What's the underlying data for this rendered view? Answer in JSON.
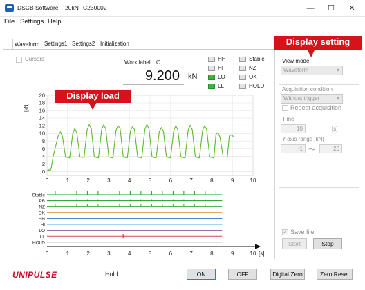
{
  "window": {
    "title_app": "DSCB Software",
    "title_capacity": "20kN",
    "title_serial": "C230002",
    "controls": [
      "—",
      "☐",
      "✕"
    ]
  },
  "menu": [
    "File",
    "Settings",
    "Help"
  ],
  "tabs": [
    "Waveform",
    "Settings1",
    "Settings2",
    "Initialization"
  ],
  "cursors_label": "Cursors",
  "work_label": {
    "label": "Work label:",
    "value": "O"
  },
  "load": {
    "value": "9.200",
    "unit": "kN"
  },
  "judgments": [
    {
      "label": "HH",
      "on": false
    },
    {
      "label": "HI",
      "on": false
    },
    {
      "label": "LO",
      "on": true
    },
    {
      "label": "LL",
      "on": true
    }
  ],
  "states": [
    {
      "label": "Stable",
      "on": false
    },
    {
      "label": "NZ",
      "on": false
    },
    {
      "label": "OK",
      "on": false
    },
    {
      "label": "HOLD",
      "on": false
    }
  ],
  "settings_panel": {
    "view_mode_label": "View mode",
    "view_mode_value": "Waveform",
    "acquisition_label": "Acquisition condition",
    "acquisition_value": "Without trigger",
    "repeat_label": "Repeat acquisition",
    "time_label": "Time",
    "time_value": "10",
    "time_unit": "[s]",
    "yrange_label": "Y-axis range [kN]",
    "yrange_min": "-1",
    "yrange_sep": "〜",
    "yrange_max": "20",
    "save_label": "Save file",
    "start_label": "Start",
    "stop_label": "Stop"
  },
  "callouts": {
    "display_load": "Display load",
    "display_setting": "Display setting"
  },
  "footer": {
    "brand": "UNIPULSE",
    "hold_label": "Hold :",
    "on_label": "ON",
    "off_label": "OFF",
    "digital_zero": "Digital Zero",
    "zero_reset": "Zero Reset"
  },
  "colors": {
    "trace": "#5cb82e",
    "callout": "#d7121a",
    "lamp_on": "#3db43d",
    "brand": "#c8102e"
  },
  "chart_data": {
    "type": "line",
    "ylabel": "[kN]",
    "xlabel": "[s]",
    "xlim": [
      0,
      10
    ],
    "ylim": [
      -1,
      20
    ],
    "x_ticks": [
      0,
      1,
      2,
      3,
      4,
      5,
      6,
      7,
      8,
      9,
      10
    ],
    "y_ticks": [
      0,
      2,
      4,
      6,
      8,
      10,
      12,
      14,
      16,
      18,
      20
    ],
    "grid": true,
    "series": [
      {
        "x": [
          0.0,
          0.05,
          0.1,
          0.15,
          0.2,
          0.3,
          0.55,
          0.65,
          0.75,
          0.9,
          1.1,
          1.25,
          1.35,
          1.45,
          1.6,
          1.8,
          1.95,
          2.05,
          2.15,
          2.3,
          2.5,
          2.65,
          2.75,
          2.85,
          3.0,
          3.2,
          3.35,
          3.45,
          3.55,
          3.7,
          3.9,
          4.05,
          4.15,
          4.25,
          4.4,
          4.6,
          4.75,
          4.85,
          4.95,
          5.1,
          5.3,
          5.45,
          5.55,
          5.65,
          5.8,
          6.0,
          6.15,
          6.25,
          6.35,
          6.5,
          6.7,
          6.85,
          6.95,
          7.05,
          7.2,
          7.4,
          7.55,
          7.65,
          7.75,
          7.9,
          8.1,
          8.2,
          8.3,
          8.4,
          8.55,
          8.75,
          8.85,
          8.95,
          9.05
        ],
        "values": [
          0.3,
          0.2,
          0.5,
          0.2,
          0.8,
          4.0,
          9.5,
          10.4,
          9.3,
          3.8,
          3.6,
          10.0,
          11.3,
          10.1,
          3.8,
          3.7,
          11.0,
          12.3,
          11.2,
          3.8,
          3.6,
          11.0,
          12.2,
          11.3,
          3.8,
          3.6,
          10.8,
          12.0,
          11.2,
          3.8,
          3.6,
          10.7,
          11.8,
          11.0,
          3.8,
          3.6,
          11.0,
          12.4,
          11.2,
          3.8,
          3.6,
          10.5,
          11.5,
          10.6,
          3.8,
          3.6,
          10.8,
          12.0,
          11.0,
          3.8,
          3.6,
          10.8,
          12.1,
          11.0,
          3.8,
          3.6,
          10.8,
          12.0,
          11.0,
          3.8,
          3.6,
          9.8,
          10.2,
          9.0,
          3.8,
          3.8,
          9.3,
          9.6,
          9.2
        ]
      }
    ]
  },
  "signal_chart": {
    "xlabel": "[s]",
    "x_ticks": [
      0,
      1,
      2,
      3,
      4,
      5,
      6,
      7,
      8,
      9,
      10
    ],
    "signals": [
      {
        "name": "Stable",
        "color": "#1f9a1f"
      },
      {
        "name": "PB",
        "color": "#1f9a1f"
      },
      {
        "name": "NZ",
        "color": "#1f9a1f"
      },
      {
        "name": "OK",
        "color": "#e08a1e"
      },
      {
        "name": "HH",
        "color": "#3a6bd6"
      },
      {
        "name": "HI",
        "color": "#5aa7e0"
      },
      {
        "name": "LO",
        "color": "#8a5aa0"
      },
      {
        "name": "LL",
        "color": "#d84848"
      },
      {
        "name": "HOLD",
        "color": "#7a7a7a"
      }
    ]
  }
}
